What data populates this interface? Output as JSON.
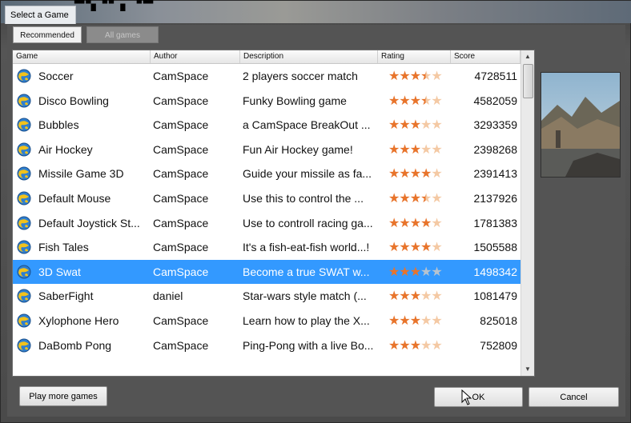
{
  "window": {
    "title": "Select a Game"
  },
  "tabs": [
    {
      "label": "Recommended"
    },
    {
      "label": "All games"
    }
  ],
  "columns": [
    "Game",
    "Author",
    "Description",
    "Rating",
    "Score"
  ],
  "rows": [
    {
      "game": "Soccer",
      "author": "CamSpace",
      "description": "2 players soccer match",
      "rating": 3.5,
      "score": "4728511"
    },
    {
      "game": "Disco Bowling",
      "author": "CamSpace",
      "description": "Funky Bowling game",
      "rating": 3.5,
      "score": "4582059"
    },
    {
      "game": "Bubbles",
      "author": "CamSpace",
      "description": "a CamSpace BreakOut ...",
      "rating": 3,
      "score": "3293359"
    },
    {
      "game": "Air Hockey",
      "author": "CamSpace",
      "description": "Fun Air Hockey game!",
      "rating": 3,
      "score": "2398268"
    },
    {
      "game": "Missile Game 3D",
      "author": "CamSpace",
      "description": "Guide your missile as fa...",
      "rating": 4,
      "score": "2391413"
    },
    {
      "game": "Default Mouse",
      "author": "CamSpace",
      "description": "Use this to control the ...",
      "rating": 3.5,
      "score": "2137926"
    },
    {
      "game": "Default Joystick St...",
      "author": "CamSpace",
      "description": "Use to controll racing ga...",
      "rating": 4,
      "score": "1781383"
    },
    {
      "game": "Fish Tales",
      "author": "CamSpace",
      "description": "It's a fish-eat-fish world...!",
      "rating": 4,
      "score": "1505588"
    },
    {
      "game": "3D Swat",
      "author": "CamSpace",
      "description": "Become a true SWAT w...",
      "rating": 3,
      "score": "1498342",
      "selected": true
    },
    {
      "game": "SaberFight",
      "author": "daniel",
      "description": "Star-wars style match (...",
      "rating": 3,
      "score": "1081479"
    },
    {
      "game": "Xylophone Hero",
      "author": "CamSpace",
      "description": "Learn how to play the X...",
      "rating": 3,
      "score": "825018"
    },
    {
      "game": "DaBomb Pong",
      "author": "CamSpace",
      "description": "Ping-Pong with a live Bo...",
      "rating": 3,
      "score": "752809"
    }
  ],
  "buttons": {
    "more": "Play more games",
    "ok": "OK",
    "cancel": "Cancel"
  },
  "icons": {
    "game": "globe-game-icon",
    "scroll_up": "scroll-up-arrow-icon",
    "scroll_down": "scroll-down-arrow-icon"
  },
  "colors": {
    "selection": "#3399ff",
    "star_on": "#e8742b",
    "star_off": "#f4c9a4"
  }
}
